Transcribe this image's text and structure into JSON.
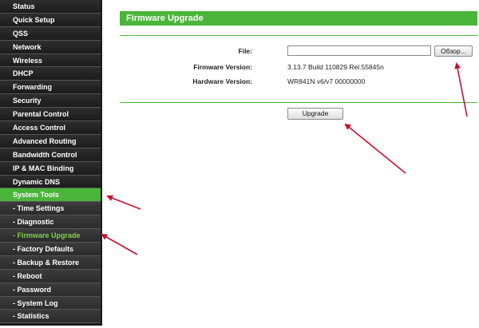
{
  "sidebar": {
    "items": [
      {
        "label": "Status",
        "type": "top"
      },
      {
        "label": "Quick Setup",
        "type": "top"
      },
      {
        "label": "QSS",
        "type": "top"
      },
      {
        "label": "Network",
        "type": "top"
      },
      {
        "label": "Wireless",
        "type": "top"
      },
      {
        "label": "DHCP",
        "type": "top"
      },
      {
        "label": "Forwarding",
        "type": "top"
      },
      {
        "label": "Security",
        "type": "top"
      },
      {
        "label": "Parental Control",
        "type": "top"
      },
      {
        "label": "Access Control",
        "type": "top"
      },
      {
        "label": "Advanced Routing",
        "type": "top"
      },
      {
        "label": "Bandwidth Control",
        "type": "top"
      },
      {
        "label": "IP & MAC Binding",
        "type": "top"
      },
      {
        "label": "Dynamic DNS",
        "type": "top"
      },
      {
        "label": "System Tools",
        "type": "active"
      },
      {
        "label": "- Time Settings",
        "type": "sub"
      },
      {
        "label": "- Diagnostic",
        "type": "sub"
      },
      {
        "label": "- Firmware Upgrade",
        "type": "sub-active"
      },
      {
        "label": "- Factory Defaults",
        "type": "sub"
      },
      {
        "label": "- Backup & Restore",
        "type": "sub"
      },
      {
        "label": "- Reboot",
        "type": "sub"
      },
      {
        "label": "- Password",
        "type": "sub"
      },
      {
        "label": "- System Log",
        "type": "sub"
      },
      {
        "label": "- Statistics",
        "type": "sub"
      }
    ]
  },
  "main": {
    "title": "Firmware Upgrade",
    "file_label": "File:",
    "file_value": "",
    "browse_label": "Обзор...",
    "firmware_version_label": "Firmware Version:",
    "firmware_version_value": "3.13.7 Build 110829 Rel.55845n",
    "hardware_version_label": "Hardware Version:",
    "hardware_version_value": "WR841N v6/v7 00000000",
    "upgrade_label": "Upgrade"
  },
  "colors": {
    "accent_green": "#4ab53a",
    "annotation_arrow": "#c8102e",
    "sidebar_bg": "#2a2a2a"
  }
}
